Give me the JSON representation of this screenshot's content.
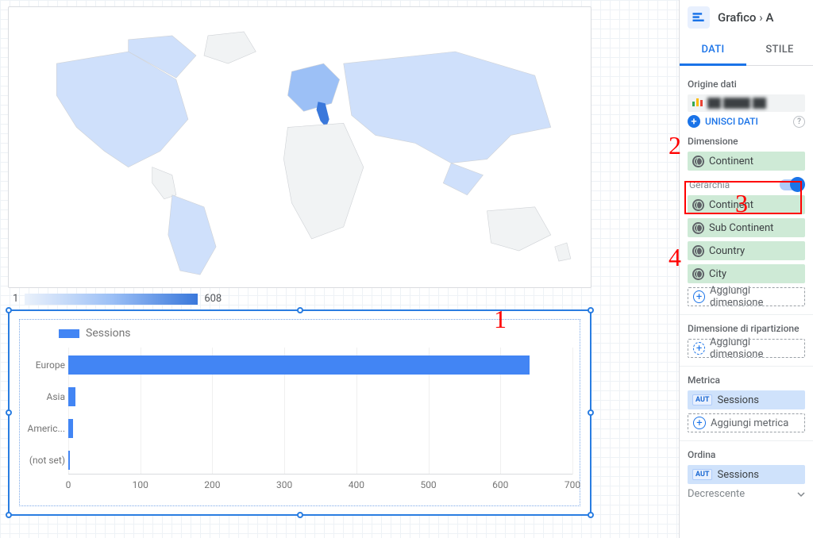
{
  "legend": {
    "min": "1",
    "max": "608"
  },
  "chart_data": {
    "type": "bar",
    "orientation": "horizontal",
    "title": "",
    "series_name": "Sessions",
    "categories": [
      "Europe",
      "Asia",
      "Americ...",
      "(not set)"
    ],
    "values": [
      640,
      10,
      7,
      2
    ],
    "xlim": [
      0,
      700
    ],
    "xticks": [
      0,
      100,
      200,
      300,
      400,
      500,
      600,
      700
    ]
  },
  "annotations": {
    "n1": "1",
    "n2": "2",
    "n3": "3",
    "n4": "4"
  },
  "sidebar": {
    "breadcrumb": {
      "root": "Grafico",
      "sep": "›",
      "current": "A"
    },
    "tabs": {
      "data": "DATI",
      "style": "STILE"
    },
    "source": {
      "label": "Origine dati",
      "name": "██ ████ ██",
      "merge": "UNISCI DATI"
    },
    "dimension": {
      "label": "Dimensione",
      "top_field": "Continent",
      "hierarchy_label": "Gerarchia",
      "fields": [
        "Continent",
        "Sub Continent",
        "Country",
        "City"
      ],
      "add": "Aggiungi dimensione"
    },
    "breakdown": {
      "label": "Dimensione di ripartizione",
      "add": "Aggiungi dimensione"
    },
    "metric": {
      "label": "Metrica",
      "field": "Sessions",
      "badge": "AUT",
      "add": "Aggiungi metrica"
    },
    "sort": {
      "label": "Ordina",
      "field": "Sessions",
      "badge": "AUT",
      "order": "Decrescente"
    }
  }
}
